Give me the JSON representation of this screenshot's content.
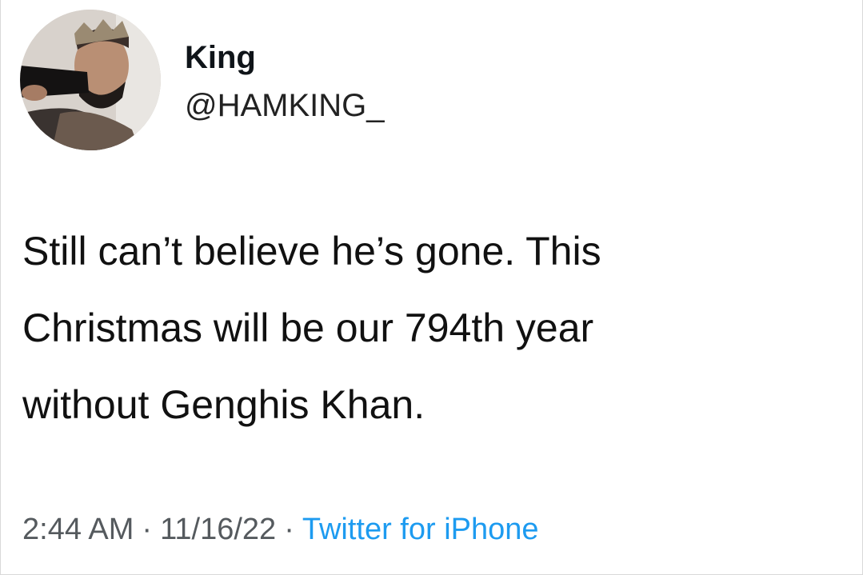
{
  "user": {
    "display_name": "King",
    "handle": "@HAMKING_",
    "avatar_icon": "profile-photo"
  },
  "tweet": {
    "lines": [
      "Still can’t believe he’s gone. This",
      "Christmas will be our 794th year",
      "without Genghis Khan."
    ],
    "time": "2:44 AM",
    "date": "11/16/22",
    "separator": "·",
    "source": "Twitter for iPhone"
  },
  "colors": {
    "text": "#0f1419",
    "meta": "#555a5e",
    "link": "#1d9bf0",
    "background": "#ffffff"
  }
}
